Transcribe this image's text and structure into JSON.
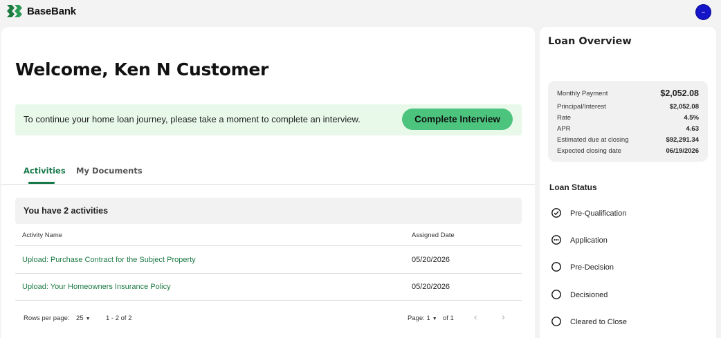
{
  "app": {
    "name": "BaseBank",
    "avatar_initial": "–"
  },
  "main": {
    "welcome": "Welcome, Ken N Customer",
    "banner": {
      "text": "To continue your home loan journey, please take a moment to complete an interview.",
      "button_label": "Complete Interview"
    },
    "tabs": [
      {
        "label": "Activities",
        "active": true
      },
      {
        "label": "My Documents",
        "active": false
      }
    ],
    "activities": {
      "title": "You have 2 activities",
      "columns": [
        "Activity Name",
        "Assigned Date"
      ],
      "rows": [
        {
          "name": "Upload: Purchase Contract for the Subject Property",
          "date": "05/20/2026"
        },
        {
          "name": "Upload: Your Homeowners Insurance Policy",
          "date": "05/20/2026"
        }
      ]
    },
    "pagination": {
      "rows_per_page_label": "Rows per page:",
      "rows_per_page_value": "25",
      "range": "1 - 2 of 2",
      "page_label": "Page: 1",
      "of_label": "of 1"
    }
  },
  "sidebar": {
    "overview_title": "Loan Overview",
    "overview": [
      {
        "label": "Monthly Payment",
        "value": "$2,052.08"
      },
      {
        "label": "Principal/Interest",
        "value": "$2,052.08"
      },
      {
        "label": "Rate",
        "value": "4.5%"
      },
      {
        "label": "APR",
        "value": "4.63"
      },
      {
        "label": "Estimated due at closing",
        "value": "$92,291.34"
      },
      {
        "label": "Expected closing date",
        "value": "06/19/2026"
      }
    ],
    "status_title": "Loan Status",
    "status_steps": [
      {
        "label": "Pre-Qualification",
        "state": "complete"
      },
      {
        "label": "Application",
        "state": "in-progress"
      },
      {
        "label": "Pre-Decision",
        "state": "pending"
      },
      {
        "label": "Decisioned",
        "state": "pending"
      },
      {
        "label": "Cleared to Close",
        "state": "pending"
      }
    ]
  },
  "colors": {
    "brand_green": "#17794a",
    "cta_green": "#4cc47e",
    "banner_bg": "#e8f9ea",
    "avatar_blue": "#1414c8"
  }
}
